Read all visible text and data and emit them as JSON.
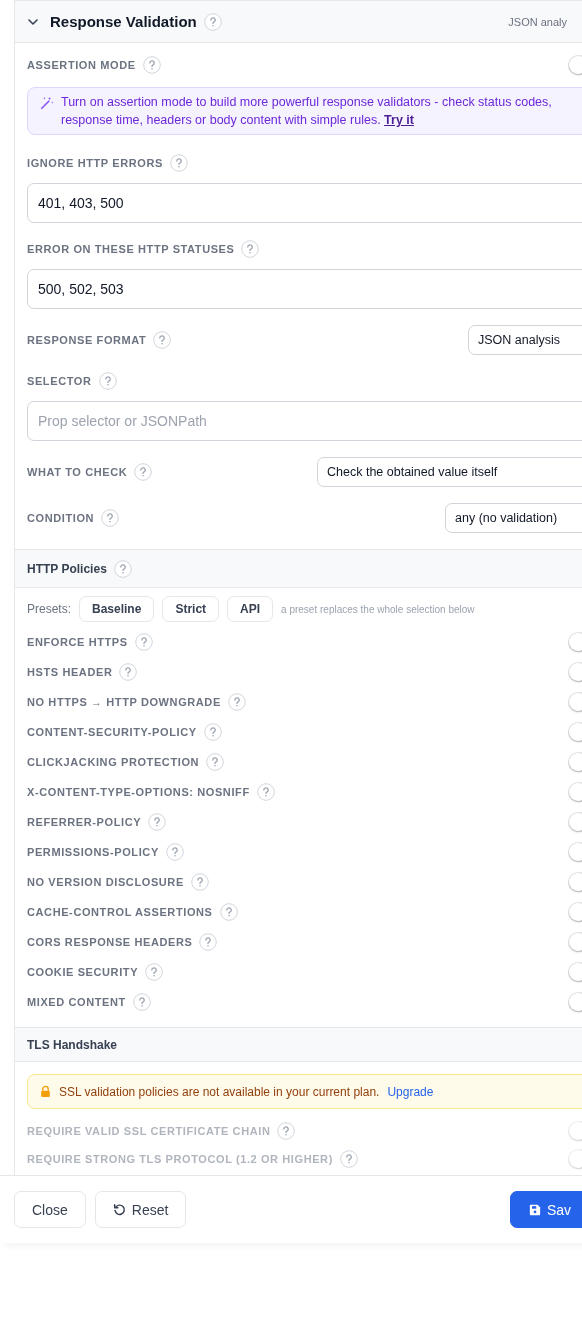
{
  "response_validation": {
    "title": "Response Validation",
    "summary": "JSON analy",
    "expanded": true,
    "assertion_mode": {
      "label": "ASSERTION MODE",
      "on": false
    },
    "info": {
      "text": "Turn on assertion mode to build more powerful response validators - check status codes, response time, headers or body content with simple rules.",
      "link": "Try it"
    },
    "fields": [
      {
        "kind": "input",
        "label": "IGNORE HTTP ERRORS",
        "value": "401, 403, 500"
      },
      {
        "kind": "input",
        "label": "ERROR ON THESE HTTP STATUSES",
        "value": "500, 502, 503"
      },
      {
        "kind": "select",
        "label": "RESPONSE FORMAT",
        "value": "JSON analysis"
      },
      {
        "kind": "input",
        "label": "SELECTOR",
        "placeholder": "Prop selector or JSONPath"
      },
      {
        "kind": "select",
        "label": "WHAT TO CHECK",
        "value": "Check the obtained value itself"
      },
      {
        "kind": "select",
        "label": "CONDITION",
        "value": "any (no validation)"
      }
    ]
  },
  "http_policies": {
    "title": "HTTP Policies",
    "presets_label": "Presets:",
    "presets": [
      "Baseline",
      "Strict",
      "API"
    ],
    "presets_hint": "a preset replaces the whole selection below",
    "policies": [
      {
        "label": "ENFORCE HTTPS",
        "on": false
      },
      {
        "label": "HSTS HEADER",
        "on": false
      },
      {
        "label": "NO HTTPS → HTTP DOWNGRADE",
        "on": false
      },
      {
        "label": "CONTENT-SECURITY-POLICY",
        "on": false
      },
      {
        "label": "CLICKJACKING PROTECTION",
        "on": false
      },
      {
        "label": "X-CONTENT-TYPE-OPTIONS: NOSNIFF",
        "on": false
      },
      {
        "label": "REFERRER-POLICY",
        "on": false
      },
      {
        "label": "PERMISSIONS-POLICY",
        "on": false
      },
      {
        "label": "NO VERSION DISCLOSURE",
        "on": false
      },
      {
        "label": "CACHE-CONTROL ASSERTIONS",
        "on": false
      },
      {
        "label": "CORS RESPONSE HEADERS",
        "on": false
      },
      {
        "label": "COOKIE SECURITY",
        "on": false
      },
      {
        "label": "MIXED CONTENT",
        "on": false
      }
    ]
  },
  "tls_handshake": {
    "title": "TLS Handshake",
    "notice": {
      "text": "SSL validation policies are not available in your current plan.",
      "link": "Upgrade"
    },
    "policies": [
      {
        "label": "REQUIRE VALID SSL CERTIFICATE CHAIN",
        "on": false,
        "disabled": true
      },
      {
        "label": "REQUIRE STRONG TLS PROTOCOL (1.2 OR HIGHER)",
        "on": false,
        "disabled": true
      }
    ]
  },
  "footer": {
    "close": "Close",
    "reset": "Reset",
    "save": "Sav"
  }
}
